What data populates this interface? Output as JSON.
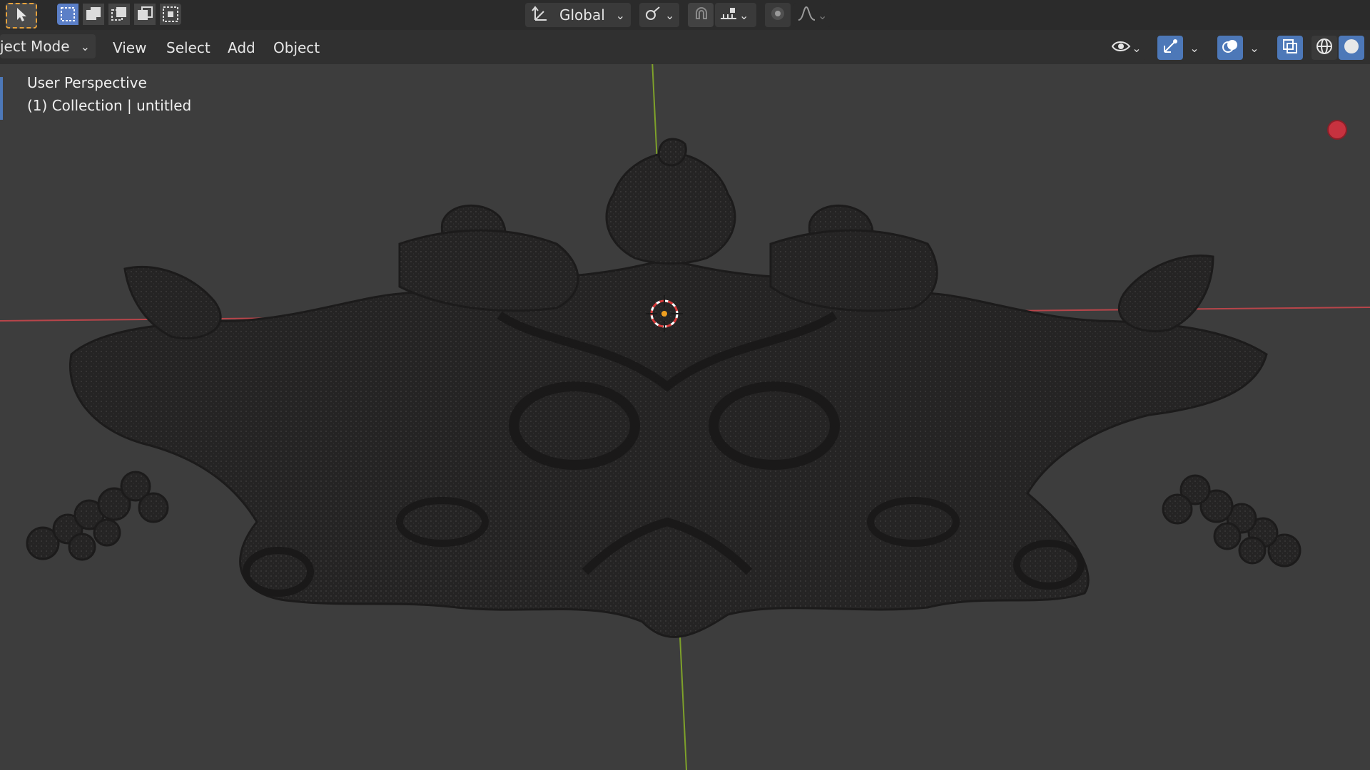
{
  "header": {
    "transform_orientation": "Global",
    "mode_label": "ject Mode"
  },
  "menus": {
    "view": "View",
    "select": "Select",
    "add": "Add",
    "object": "Object"
  },
  "viewport": {
    "perspective_label": "User Perspective",
    "collection_label": "(1) Collection | untitled"
  },
  "colors": {
    "x_axis": "#b8454a",
    "y_axis": "#7ea12a",
    "accent_blue": "#4d78b8",
    "active_tool_border": "#e6a23c",
    "model": "#252424"
  },
  "icons": {
    "select_tool": "cursor-arrow-icon",
    "selection_modes": [
      "select-new-icon",
      "select-extend-icon",
      "select-subtract-icon",
      "select-invert-icon",
      "select-intersect-icon"
    ],
    "orientation": "transform-orientation-icon",
    "pivot": "pivot-point-icon",
    "snap": "snap-magnet-icon",
    "snap_target": "snap-increment-icon",
    "proportional": "proportional-editing-icon",
    "falloff": "falloff-curve-icon",
    "visibility": "eye-visibility-icon",
    "gizmo": "gizmo-icon",
    "overlays": "overlays-icon",
    "xray": "xray-icon",
    "wireframe": "wireframe-shading-icon",
    "solid": "solid-shading-icon",
    "record": "record-icon"
  }
}
